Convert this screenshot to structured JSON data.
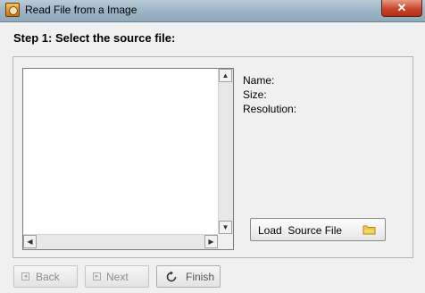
{
  "window": {
    "title": "Read File from a Image",
    "close_label": "✕"
  },
  "step": {
    "title": "Step 1: Select the source file:"
  },
  "info": {
    "name_label": "Name:",
    "size_label": "Size:",
    "resolution_label": "Resolution:"
  },
  "load_button": {
    "label": "Load  Source File",
    "icon": "folder-icon"
  },
  "nav": {
    "back_label": "Back",
    "next_label": "Next",
    "finish_label": "Finish"
  },
  "colors": {
    "title_bar": "#9fb6c7",
    "close_button": "#c8452a",
    "window_bg": "#f0f0f0"
  }
}
